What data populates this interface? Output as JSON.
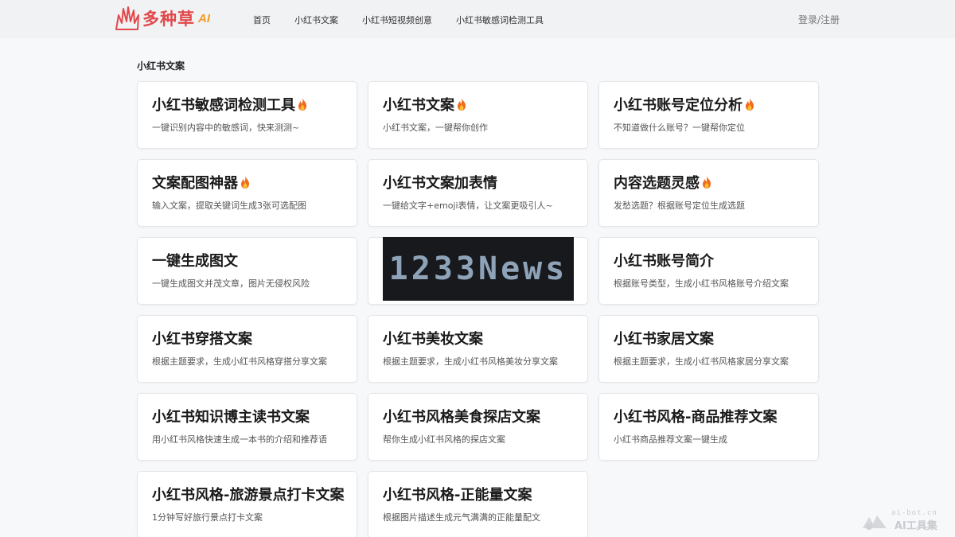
{
  "header": {
    "logo_text": "多种草",
    "logo_ai": "AI",
    "nav": [
      "首页",
      "小红书文案",
      "小红书短视频创意",
      "小红书敏感词检测工具"
    ],
    "login": "登录/注册"
  },
  "section_title": "小红书文案",
  "cards": [
    {
      "title": "小红书敏感词检测工具",
      "desc": "一键识别内容中的敏感词，快来测测~",
      "hot": true
    },
    {
      "title": "小红书文案",
      "desc": "小红书文案，一键帮你创作",
      "hot": true
    },
    {
      "title": "小红书账号定位分析",
      "desc": "不知道做什么账号？一键帮你定位",
      "hot": true
    },
    {
      "title": "文案配图神器",
      "desc": "输入文案，提取关键词生成3张可选配图",
      "hot": true
    },
    {
      "title": "小红书文案加表情",
      "desc": "一键给文字+emoji表情，让文案更吸引人~",
      "hot": false
    },
    {
      "title": "内容选题灵感",
      "desc": "发愁选题？根据账号定位生成选题",
      "hot": true
    },
    {
      "title": "一键生成图文",
      "desc": "一键生成图文并茂文章，图片无侵权风险",
      "hot": false
    },
    {
      "title": "",
      "desc": "",
      "hot": false,
      "ad_text": "1233News"
    },
    {
      "title": "小红书账号简介",
      "desc": "根据账号类型，生成小红书风格账号介绍文案",
      "hot": false
    },
    {
      "title": "小红书穿搭文案",
      "desc": "根据主题要求，生成小红书风格穿搭分享文案",
      "hot": false
    },
    {
      "title": "小红书美妆文案",
      "desc": "根据主题要求，生成小红书风格美妆分享文案",
      "hot": false
    },
    {
      "title": "小红书家居文案",
      "desc": "根据主题要求，生成小红书风格家居分享文案",
      "hot": false
    },
    {
      "title": "小红书知识博主读书文案",
      "desc": "用小红书风格快速生成一本书的介绍和推荐语",
      "hot": false
    },
    {
      "title": "小红书风格美食探店文案",
      "desc": "帮你生成小红书风格的探店文案",
      "hot": false
    },
    {
      "title": "小红书风格-商品推荐文案",
      "desc": "小红书商品推荐文案一键生成",
      "hot": false
    },
    {
      "title": "小红书风格-旅游景点打卡文案",
      "desc": "1分钟写好旅行景点打卡文案",
      "hot": false
    },
    {
      "title": "小红书风格-正能量文案",
      "desc": "根据图片描述生成元气满满的正能量配文",
      "hot": false
    }
  ],
  "watermark": {
    "url": "ai-bot.cn",
    "name": "AI工具集"
  },
  "colors": {
    "brand": "#e2484b",
    "accent": "#f29a27",
    "background": "#f7f8fa"
  }
}
